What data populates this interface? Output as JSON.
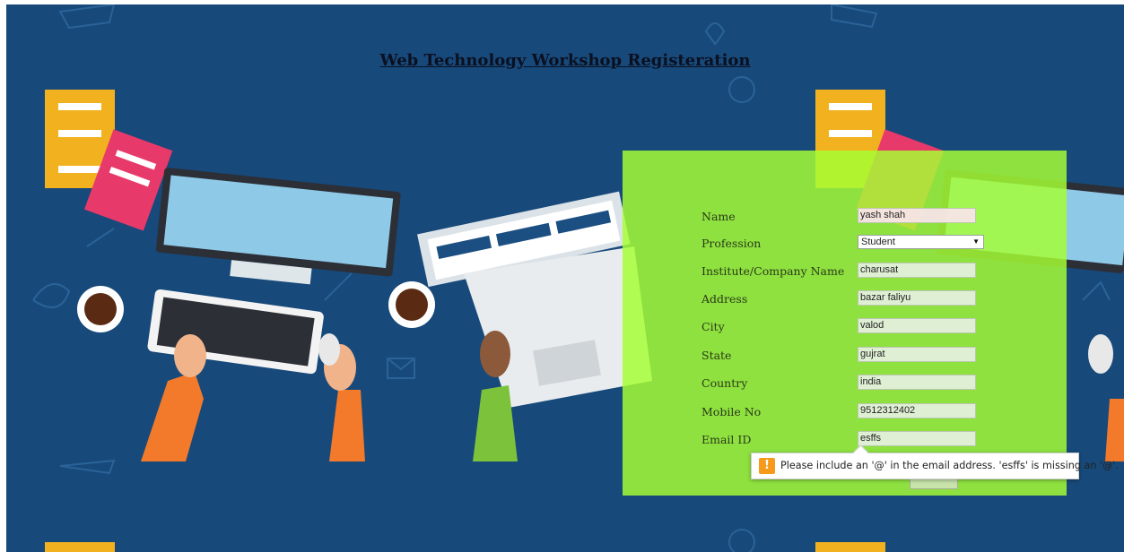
{
  "page": {
    "title": "Web Technology Workshop Registeration"
  },
  "form": {
    "fields": [
      {
        "label": "Name",
        "value": "yash shah"
      },
      {
        "label": "Profession",
        "value": "Student"
      },
      {
        "label": "Institute/Company Name",
        "value": "charusat"
      },
      {
        "label": "Address",
        "value": "bazar faliyu"
      },
      {
        "label": "City",
        "value": "valod"
      },
      {
        "label": "State",
        "value": "gujrat"
      },
      {
        "label": "Country",
        "value": "india"
      },
      {
        "label": "Mobile No",
        "value": "9512312402"
      },
      {
        "label": "Email ID",
        "value": "esffs"
      }
    ]
  },
  "validation": {
    "icon": "warning-icon",
    "glyph": "!",
    "message": "Please include an '@' in the email address. 'esffs' is missing an '@'."
  },
  "colors": {
    "background": "#17497a",
    "panel": "#a6ff33",
    "warning": "#f59a1a"
  }
}
